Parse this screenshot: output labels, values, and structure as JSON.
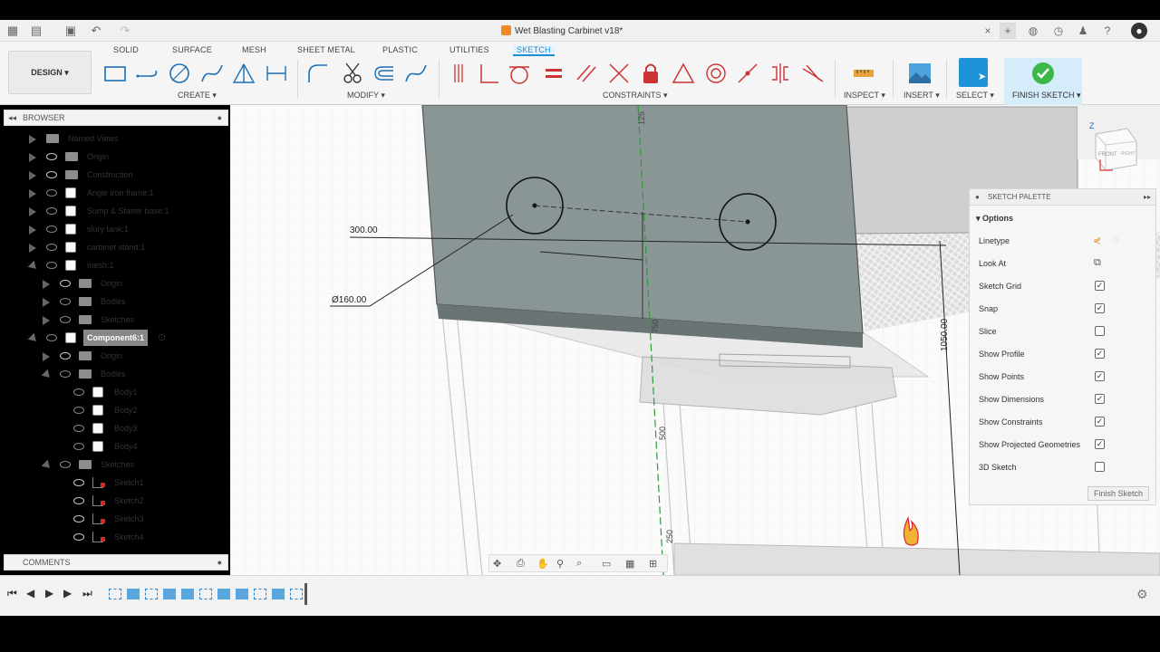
{
  "window": {
    "title": "Wet Blasting Carbinet v18*"
  },
  "toolbar": {
    "workspace_label": "DESIGN",
    "tabs": [
      {
        "label": "SOLID"
      },
      {
        "label": "SURFACE"
      },
      {
        "label": "MESH"
      },
      {
        "label": "SHEET METAL"
      },
      {
        "label": "PLASTIC"
      },
      {
        "label": "UTILITIES"
      },
      {
        "label": "SKETCH"
      }
    ],
    "groups": {
      "create": "CREATE",
      "modify": "MODIFY",
      "constraints": "CONSTRAINTS",
      "inspect": "INSPECT",
      "insert": "INSERT",
      "select": "SELECT",
      "finish": "FINISH SKETCH"
    }
  },
  "browser": {
    "title": "BROWSER",
    "items": [
      {
        "label": "Named Views"
      },
      {
        "label": "Origin"
      },
      {
        "label": "Construction"
      },
      {
        "label": "Angle iron frame:1"
      },
      {
        "label": "Sump & Stairer base:1"
      },
      {
        "label": "slury tank:1"
      },
      {
        "label": "carbinet stand:1"
      },
      {
        "label": "mesh:1"
      },
      {
        "label": "Origin"
      },
      {
        "label": "Bodies"
      },
      {
        "label": "Sketches"
      },
      {
        "label": "Component6:1"
      },
      {
        "label": "Origin"
      },
      {
        "label": "Bodies"
      },
      {
        "label": "Body1"
      },
      {
        "label": "Body2"
      },
      {
        "label": "Body3"
      },
      {
        "label": "Body4"
      },
      {
        "label": "Sketches"
      },
      {
        "label": "Sketch1"
      },
      {
        "label": "Sketch2"
      },
      {
        "label": "Sketch3"
      },
      {
        "label": "Sketch4"
      }
    ]
  },
  "comments": {
    "title": "COMMENTS"
  },
  "viewport": {
    "dimensions": [
      "300.00",
      "Ø160.00",
      "125",
      "1050.00",
      "750",
      "500",
      "250"
    ],
    "viewcube": {
      "front": "FRONT",
      "right": "RIGHT"
    }
  },
  "sketch_palette": {
    "title": "SKETCH PALETTE",
    "section": "Options",
    "options": [
      {
        "label": "Linetype",
        "kind": "icon"
      },
      {
        "label": "Look At",
        "kind": "icon"
      },
      {
        "label": "Sketch Grid",
        "checked": true
      },
      {
        "label": "Snap",
        "checked": true
      },
      {
        "label": "Slice",
        "checked": false
      },
      {
        "label": "Show Profile",
        "checked": true
      },
      {
        "label": "Show Points",
        "checked": true
      },
      {
        "label": "Show Dimensions",
        "checked": true
      },
      {
        "label": "Show Constraints",
        "checked": true
      },
      {
        "label": "Show Projected Geometries",
        "checked": true
      },
      {
        "label": "3D Sketch",
        "checked": false
      }
    ],
    "finish_button": "Finish Sketch"
  },
  "colors": {
    "accent": "#1a8fd6",
    "finish_green": "#3cb84a",
    "panel_face": "#8a9595"
  }
}
